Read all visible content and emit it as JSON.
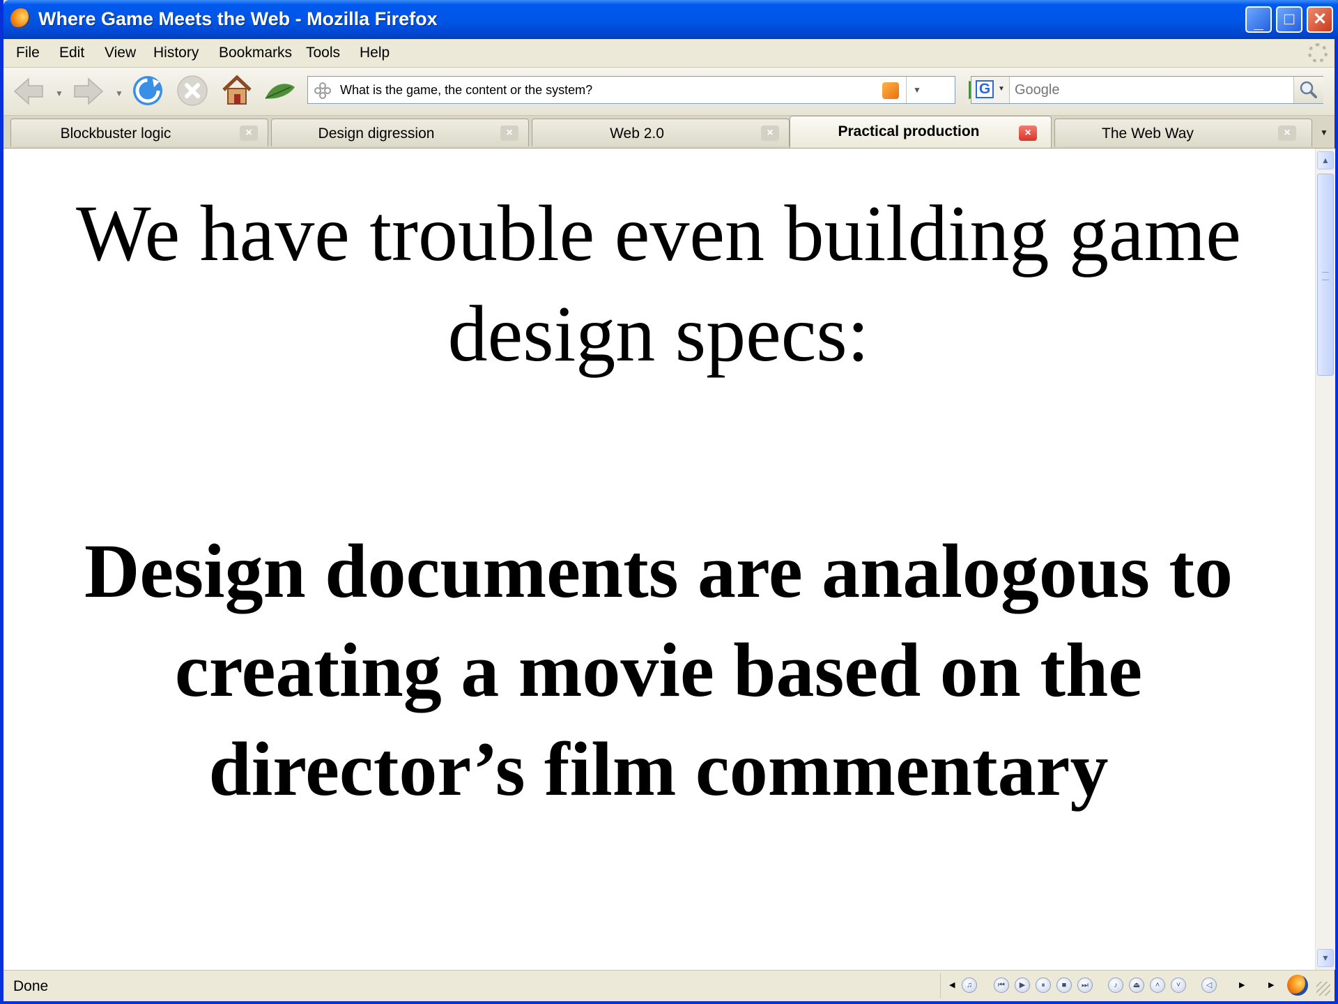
{
  "window": {
    "title": "Where Game Meets the Web - Mozilla Firefox",
    "controls": {
      "minimize": "minimize",
      "maximize": "maximize",
      "close": "close"
    }
  },
  "menu": {
    "items": [
      {
        "label": "File",
        "key": "file"
      },
      {
        "label": "Edit",
        "key": "edit"
      },
      {
        "label": "View",
        "key": "view"
      },
      {
        "label": "History",
        "key": "history"
      },
      {
        "label": "Bookmarks",
        "key": "bookmarks"
      },
      {
        "label": "Tools",
        "key": "tools"
      },
      {
        "label": "Help",
        "key": "help"
      }
    ]
  },
  "toolbar": {
    "icons": [
      "back-icon",
      "forward-icon",
      "reload-icon",
      "stop-icon",
      "home-icon",
      "leaf-icon"
    ],
    "url": "What is the game, the content or the system?",
    "search_placeholder": "Google",
    "search_engine": "G"
  },
  "tabs": [
    {
      "label": "Blockbuster logic",
      "active": false
    },
    {
      "label": "Design digression",
      "active": false
    },
    {
      "label": "Web 2.0",
      "active": false
    },
    {
      "label": "Practical production",
      "active": true
    },
    {
      "label": "The Web Way",
      "active": false
    }
  ],
  "content": {
    "heading": "We have trouble even building game design specs:",
    "statement": "Design documents are analogous to creating a movie based on the director’s film commentary"
  },
  "status": {
    "text": "Done"
  },
  "colors": {
    "titlebar": "#0055e5",
    "chrome": "#ece9d8",
    "active_tab_close": "#d9342a"
  }
}
